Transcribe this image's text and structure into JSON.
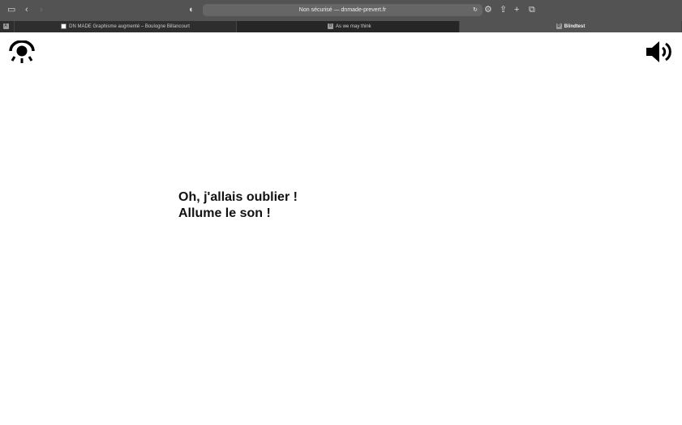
{
  "browser": {
    "url_text": "Non sécurisé — dnmade-prevert.fr",
    "tabs": [
      {
        "label": "",
        "favicon": "A"
      },
      {
        "label": "DN MADE Graphisme augmenté – Boulogne Billancourt",
        "favicon": ""
      },
      {
        "label": "As we may think",
        "favicon": "D"
      },
      {
        "label": "Blindtest",
        "favicon": "D",
        "active": true
      }
    ]
  },
  "page": {
    "line1": "Oh, j'allais oublier !",
    "line2": "Allume le son !"
  }
}
